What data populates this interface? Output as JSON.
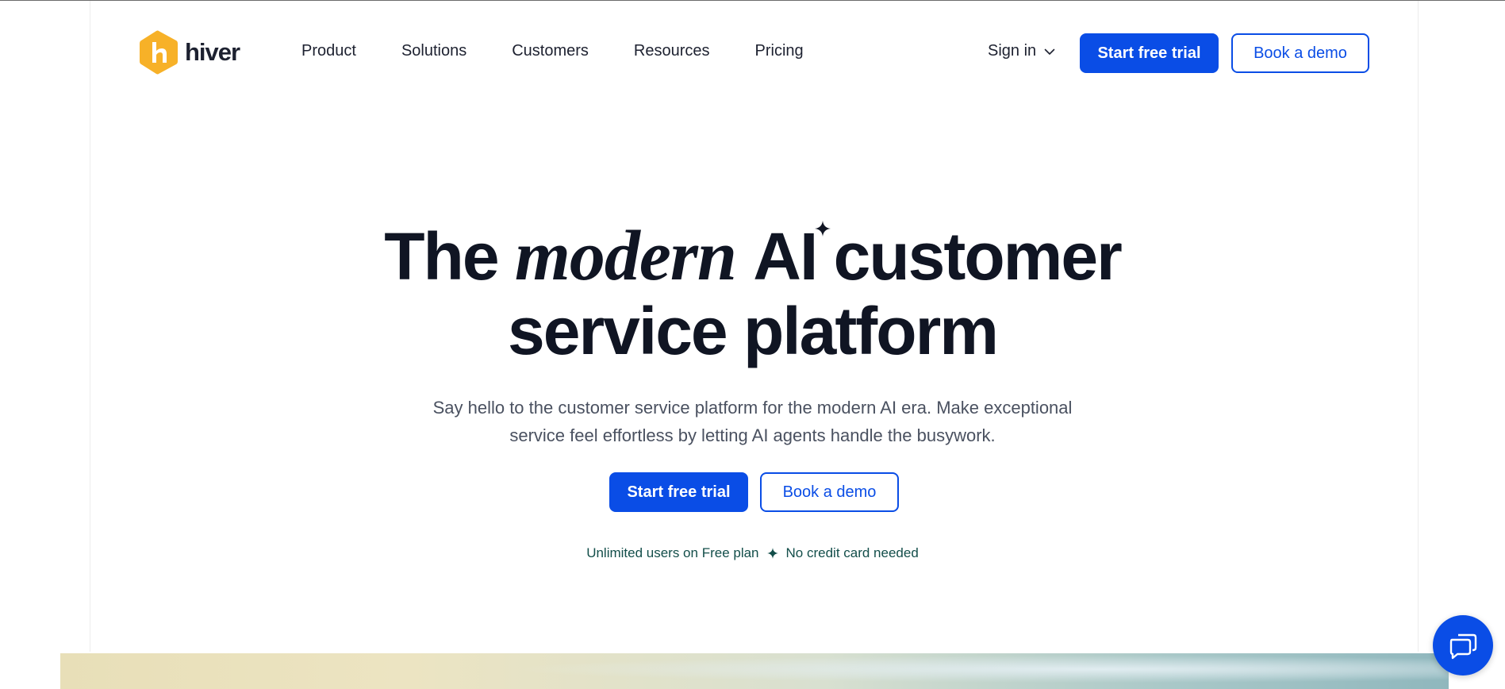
{
  "header": {
    "logo_text": "hiver",
    "nav": [
      "Product",
      "Solutions",
      "Customers",
      "Resources",
      "Pricing"
    ],
    "signin_label": "Sign in",
    "start_trial_label": "Start free trial",
    "book_demo_label": "Book a demo"
  },
  "hero": {
    "title_part1": "The",
    "title_italic": "modern",
    "title_ai": "AI",
    "title_part2": "customer",
    "title_line2": "service platform",
    "subtitle_line1": "Say hello to the customer service platform for the modern AI era. Make exceptional",
    "subtitle_line2": "service feel effortless by letting AI agents handle the busywork.",
    "start_trial_label": "Start free trial",
    "book_demo_label": "Book a demo",
    "note_left": "Unlimited users on Free plan",
    "note_right": "No credit card needed"
  },
  "icons": {
    "logo": "hiver-logo-icon",
    "signin_chevron": "chevron-down-icon",
    "sparkle": "sparkle-icon",
    "chat": "chat-bubbles-icon"
  },
  "colors": {
    "accent": "#0a4de6",
    "logo": "#f7b128",
    "text_dark": "#101523",
    "note_teal": "#134e4a"
  }
}
